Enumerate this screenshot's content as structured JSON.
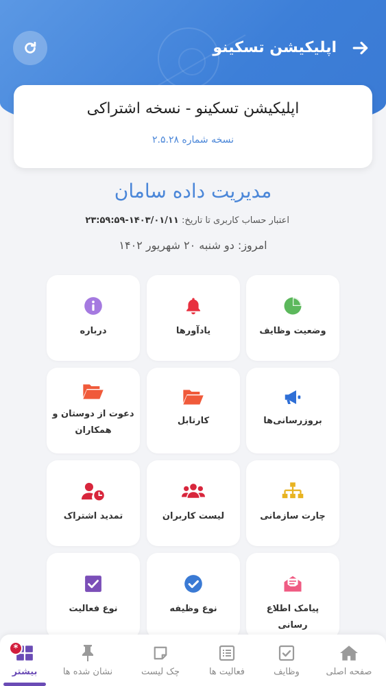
{
  "header": {
    "title": "اپلیکیشن تسکینو",
    "back_icon": "arrow-right-icon",
    "refresh_icon": "refresh-icon"
  },
  "info_card": {
    "title": "اپلیکیشن تسکینو - نسخه اشتراکی",
    "version": "نسخه شماره ۲.۵.۲۸"
  },
  "company": {
    "name": "مدیریت داده سامان",
    "validity_label": "اعتبار حساب کاربری تا تاریخ:",
    "validity_value": "۱۴۰۳/۰۱/۱۱-۲۳:۵۹:۵۹",
    "today": "امروز: دو شنبه ۲۰ شهریور ۱۴۰۲"
  },
  "tiles": [
    {
      "label": "وضعیت وظایف",
      "icon": "pie-chart-icon",
      "color": "#5cb85c"
    },
    {
      "label": "یادآورها",
      "icon": "bell-icon",
      "color": "#e8303f"
    },
    {
      "label": "درباره",
      "icon": "info-icon",
      "color": "#a57ae0"
    },
    {
      "label": "بروزرسانی‌ها",
      "icon": "megaphone-icon",
      "color": "#2f6fd6"
    },
    {
      "label": "کارتابل",
      "icon": "folder-open-icon",
      "color": "#f05a3a"
    },
    {
      "label": "دعوت از دوستان و همکاران",
      "icon": "folder-open-icon",
      "color": "#f05a3a"
    },
    {
      "label": "چارت سازمانی",
      "icon": "org-chart-icon",
      "color": "#e8b320"
    },
    {
      "label": "لیست کاربران",
      "icon": "users-icon",
      "color": "#d8263c"
    },
    {
      "label": "تمدید اشتراک",
      "icon": "user-clock-icon",
      "color": "#d8263c"
    },
    {
      "label": "پیامک اطلاع رسانی",
      "icon": "envelope-open-icon",
      "color": "#ef5b83"
    },
    {
      "label": "نوع وظیفه",
      "icon": "check-circle-icon",
      "color": "#3a7ad4"
    },
    {
      "label": "نوع فعالیت",
      "icon": "check-square-icon",
      "color": "#7b4fb8"
    }
  ],
  "bottom_nav": {
    "items": [
      {
        "label": "صفحه اصلی",
        "icon": "home-icon"
      },
      {
        "label": "وظایف",
        "icon": "check-box-icon"
      },
      {
        "label": "فعالیت ها",
        "icon": "list-icon"
      },
      {
        "label": "چک لیست",
        "icon": "note-icon"
      },
      {
        "label": "نشان شده ها",
        "icon": "pin-icon"
      },
      {
        "label": "بیشتر",
        "icon": "grid-icon"
      }
    ],
    "badge": "*",
    "active_color": "#6a4bb5"
  },
  "colors": {
    "header": "#3d7fd8",
    "accent": "#4a86d8"
  }
}
